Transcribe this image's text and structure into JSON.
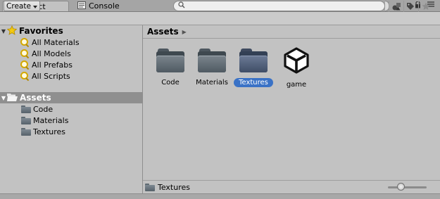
{
  "tabs": [
    {
      "label": "Project",
      "icon": "project-folder-icon",
      "active": true
    },
    {
      "label": "Console",
      "icon": "console-icon",
      "active": false
    }
  ],
  "toolbar": {
    "create_label": "Create",
    "search": {
      "value": "",
      "placeholder": ""
    }
  },
  "tree": {
    "favorites": {
      "label": "Favorites",
      "icon": "star-icon",
      "items": [
        {
          "label": "All Materials",
          "icon": "search-icon"
        },
        {
          "label": "All Models",
          "icon": "search-icon"
        },
        {
          "label": "All Prefabs",
          "icon": "search-icon"
        },
        {
          "label": "All Scripts",
          "icon": "search-icon"
        }
      ]
    },
    "assets": {
      "label": "Assets",
      "icon": "folder-open-icon",
      "selected": true,
      "items": [
        {
          "label": "Code",
          "icon": "folder-icon"
        },
        {
          "label": "Materials",
          "icon": "folder-icon"
        },
        {
          "label": "Textures",
          "icon": "folder-icon"
        }
      ]
    }
  },
  "breadcrumb": {
    "label": "Assets"
  },
  "grid": {
    "items": [
      {
        "label": "Code",
        "type": "folder",
        "selected": false
      },
      {
        "label": "Materials",
        "type": "folder",
        "selected": false
      },
      {
        "label": "Textures",
        "type": "folder",
        "selected": true
      },
      {
        "label": "game",
        "type": "unity-scene",
        "selected": false
      }
    ]
  },
  "status": {
    "label": "Textures"
  },
  "zoom_slider": {
    "value": 0.3
  },
  "colors": {
    "selection": "#3a72c6",
    "panel": "#c2c2c2",
    "tree_selection": "#8f8f8f"
  }
}
